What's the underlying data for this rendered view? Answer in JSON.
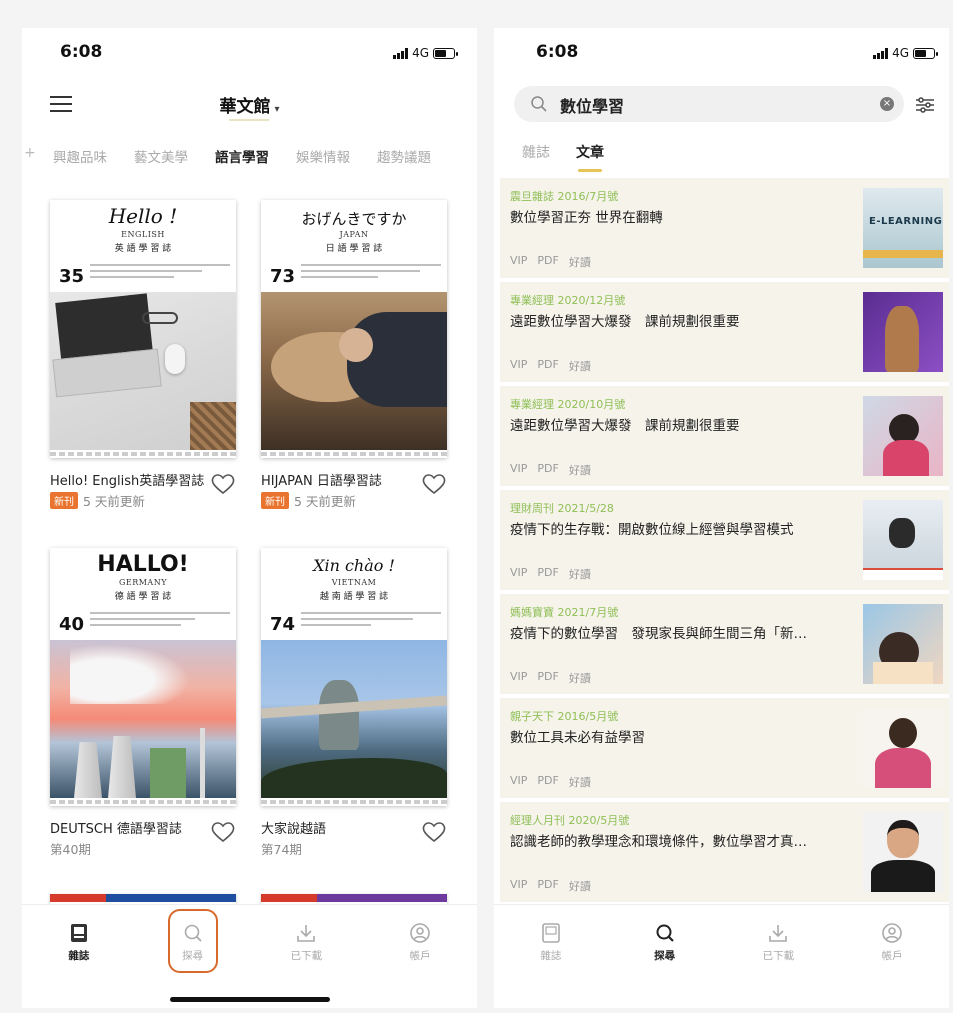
{
  "status": {
    "time": "6:08",
    "network": "4G"
  },
  "left": {
    "header": {
      "library_title": "華文館",
      "caret": "▾"
    },
    "category_tabs": [
      {
        "label": "興趣品味"
      },
      {
        "label": "藝文美學"
      },
      {
        "label": "語言學習"
      },
      {
        "label": "娛樂情報"
      },
      {
        "label": "趨勢議題"
      }
    ],
    "active_tab": "語言學習",
    "magazines": [
      {
        "name": "Hello! English英語學習誌",
        "badge": "新刊",
        "meta": "5 天前更新",
        "masthead": "Hello !",
        "sub1": "ENGLISH",
        "sub2": "英 語 學 習 誌",
        "issue": "35"
      },
      {
        "name": "HIJAPAN 日語學習誌",
        "badge": "新刊",
        "meta": "5 天前更新",
        "masthead": "おげんきですか",
        "sub1": "JAPAN",
        "sub2": "日 語 學 習 誌",
        "issue": "73"
      },
      {
        "name": "DEUTSCH 德語學習誌",
        "badge": "",
        "meta": "第40期",
        "masthead": "HALLO!",
        "sub1": "GERMANY",
        "sub2": "德 語 學 習 誌",
        "issue": "40"
      },
      {
        "name": "大家說越語",
        "badge": "",
        "meta": "第74期",
        "masthead": "Xin chào !",
        "sub1": "VIETNAM",
        "sub2": "越 南 語 學 習 誌",
        "issue": "74"
      }
    ],
    "bottom_nav": [
      {
        "label": "雜誌",
        "icon": "magazine-icon"
      },
      {
        "label": "探尋",
        "icon": "search-icon"
      },
      {
        "label": "已下載",
        "icon": "download-icon"
      },
      {
        "label": "帳戶",
        "icon": "account-icon"
      }
    ]
  },
  "right": {
    "search": {
      "query": "數位學習",
      "clear": "×"
    },
    "result_tabs": [
      {
        "label": "雜誌"
      },
      {
        "label": "文章"
      }
    ],
    "articles": [
      {
        "source": "震旦雜誌 2016/7月號",
        "title": "數位學習正夯 世界在翻轉",
        "tags": [
          "VIP",
          "PDF",
          "好讀"
        ],
        "thumb_text": "E-LEARNING"
      },
      {
        "source": "專業經理 2020/12月號",
        "title": "遠距數位學習大爆發　課前規劃很重要",
        "tags": [
          "VIP",
          "PDF",
          "好讀"
        ]
      },
      {
        "source": "專業經理 2020/10月號",
        "title": "遠距數位學習大爆發　課前規劃很重要",
        "tags": [
          "VIP",
          "PDF",
          "好讀"
        ]
      },
      {
        "source": "理財周刊 2021/5/28",
        "title": "疫情下的生存戰：開啟數位線上經營與學習模式",
        "tags": [
          "VIP",
          "PDF",
          "好讀"
        ]
      },
      {
        "source": "媽媽寶寶 2021/7月號",
        "title": "疫情下的數位學習　發現家長與師生間三角「新…",
        "tags": [
          "VIP",
          "PDF",
          "好讀"
        ]
      },
      {
        "source": "親子天下 2016/5月號",
        "title": "數位工具未必有益學習",
        "tags": [
          "VIP",
          "PDF",
          "好讀"
        ]
      },
      {
        "source": "經理人月刊 2020/5月號",
        "title": "認識老師的教學理念和環境條件，數位學習才真…",
        "tags": [
          "VIP",
          "PDF",
          "好讀"
        ]
      }
    ],
    "bottom_nav": [
      {
        "label": "雜誌",
        "icon": "magazine-icon"
      },
      {
        "label": "探尋",
        "icon": "search-icon"
      },
      {
        "label": "已下載",
        "icon": "download-icon"
      },
      {
        "label": "帳戶",
        "icon": "account-icon"
      }
    ]
  },
  "colors": {
    "accent": "#e6c556",
    "new_badge": "#e8742f",
    "source_green": "#8fbf56",
    "highlight": "#d86a2d"
  }
}
